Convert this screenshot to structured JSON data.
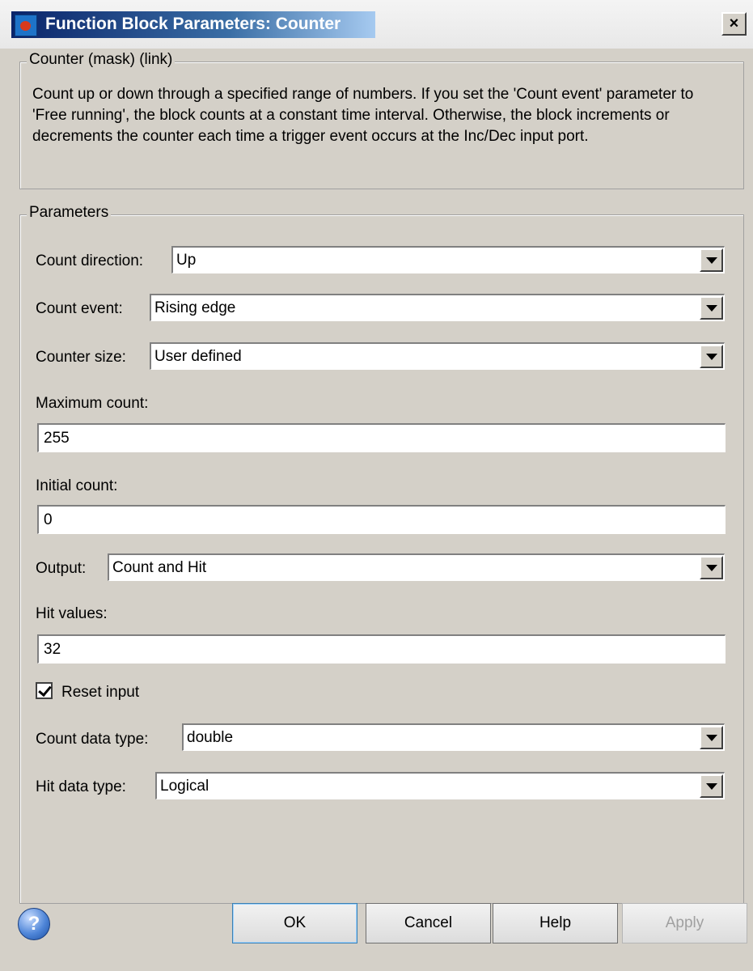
{
  "window": {
    "title": "Function Block Parameters: Counter",
    "close_label": "×"
  },
  "description": {
    "legend": "Counter (mask) (link)",
    "text": "Count up or down through a specified range of numbers. If you set the 'Count event' parameter to 'Free running', the block counts at a constant time interval. Otherwise, the block increments or decrements the counter each time a trigger event occurs at the Inc/Dec input port."
  },
  "parameters": {
    "legend": "Parameters",
    "count_direction": {
      "label": "Count direction:",
      "value": "Up"
    },
    "count_event": {
      "label": "Count event:",
      "value": "Rising edge"
    },
    "counter_size": {
      "label": "Counter size:",
      "value": "User defined"
    },
    "maximum_count": {
      "label": "Maximum count:",
      "value": "255"
    },
    "initial_count": {
      "label": "Initial count:",
      "value": "0"
    },
    "output": {
      "label": "Output:",
      "value": "Count and Hit"
    },
    "hit_values": {
      "label": "Hit values:",
      "value": "32"
    },
    "reset_input": {
      "label": "Reset input",
      "checked": true
    },
    "count_data_type": {
      "label": "Count data type:",
      "value": "double"
    },
    "hit_data_type": {
      "label": "Hit data type:",
      "value": "Logical"
    }
  },
  "buttons": {
    "help_icon": "?",
    "ok": "OK",
    "cancel": "Cancel",
    "help": "Help",
    "apply": "Apply"
  }
}
